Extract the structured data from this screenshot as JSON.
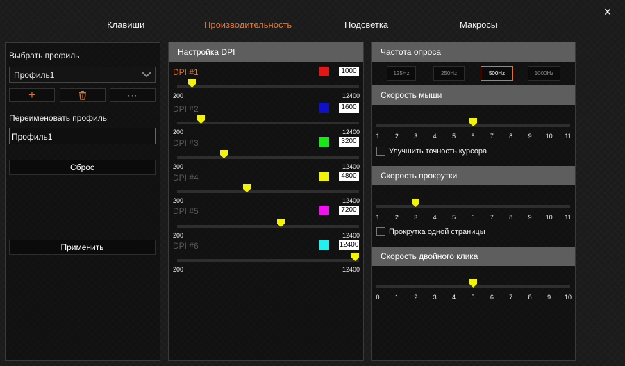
{
  "window": {
    "minimize_glyph": "–",
    "close_glyph": "✕"
  },
  "nav": {
    "tabs": [
      {
        "label": "Клавиши",
        "active": false
      },
      {
        "label": "Производительность",
        "active": true
      },
      {
        "label": "Подсветка",
        "active": false
      },
      {
        "label": "Макросы",
        "active": false
      }
    ]
  },
  "profile": {
    "select_label": "Выбрать профиль",
    "selected": "Профиль1",
    "add_glyph": "+",
    "more_glyph": "···",
    "rename_label": "Переименовать профиль",
    "rename_value": "Профиль1",
    "reset_label": "Сброс",
    "apply_label": "Применить"
  },
  "dpi": {
    "header": "Настройка DPI",
    "min_label": "200",
    "max_label": "12400",
    "min": 200,
    "max": 12400,
    "levels": [
      {
        "name": "DPI #1",
        "value": "1000",
        "color": "#e01818",
        "active": true
      },
      {
        "name": "DPI #2",
        "value": "1600",
        "color": "#1010c8",
        "active": false
      },
      {
        "name": "DPI #3",
        "value": "3200",
        "color": "#18e818",
        "active": false
      },
      {
        "name": "DPI #4",
        "value": "4800",
        "color": "#f2f20a",
        "active": false
      },
      {
        "name": "DPI #5",
        "value": "7200",
        "color": "#f010f0",
        "active": false
      },
      {
        "name": "DPI #6",
        "value": "12400",
        "color": "#20f0f0",
        "active": false
      }
    ]
  },
  "polling": {
    "header": "Частота опроса",
    "options": [
      {
        "label": "125Hz",
        "active": false
      },
      {
        "label": "250Hz",
        "active": false
      },
      {
        "label": "500Hz",
        "active": true
      },
      {
        "label": "1000Hz",
        "active": false
      }
    ]
  },
  "mouse_speed": {
    "header": "Скорость мыши",
    "ticks": [
      "1",
      "2",
      "3",
      "4",
      "5",
      "6",
      "7",
      "8",
      "9",
      "10",
      "11"
    ],
    "value": 6,
    "checkbox_label": "Улучшить точность курсора",
    "checked": false
  },
  "scroll_speed": {
    "header": "Скорость прокрутки",
    "ticks": [
      "1",
      "2",
      "3",
      "4",
      "5",
      "6",
      "7",
      "8",
      "9",
      "10",
      "11"
    ],
    "value": 3,
    "checkbox_label": "Прокрутка одной страницы",
    "checked": false
  },
  "double_click_speed": {
    "header": "Скорость двойного клика",
    "ticks": [
      "0",
      "1",
      "2",
      "3",
      "4",
      "5",
      "6",
      "7",
      "8",
      "9",
      "10"
    ],
    "value": 5
  },
  "colors": {
    "accent": "#d8742c",
    "thumb": "#f2f20a",
    "header_bg": "#5e5e5e"
  }
}
